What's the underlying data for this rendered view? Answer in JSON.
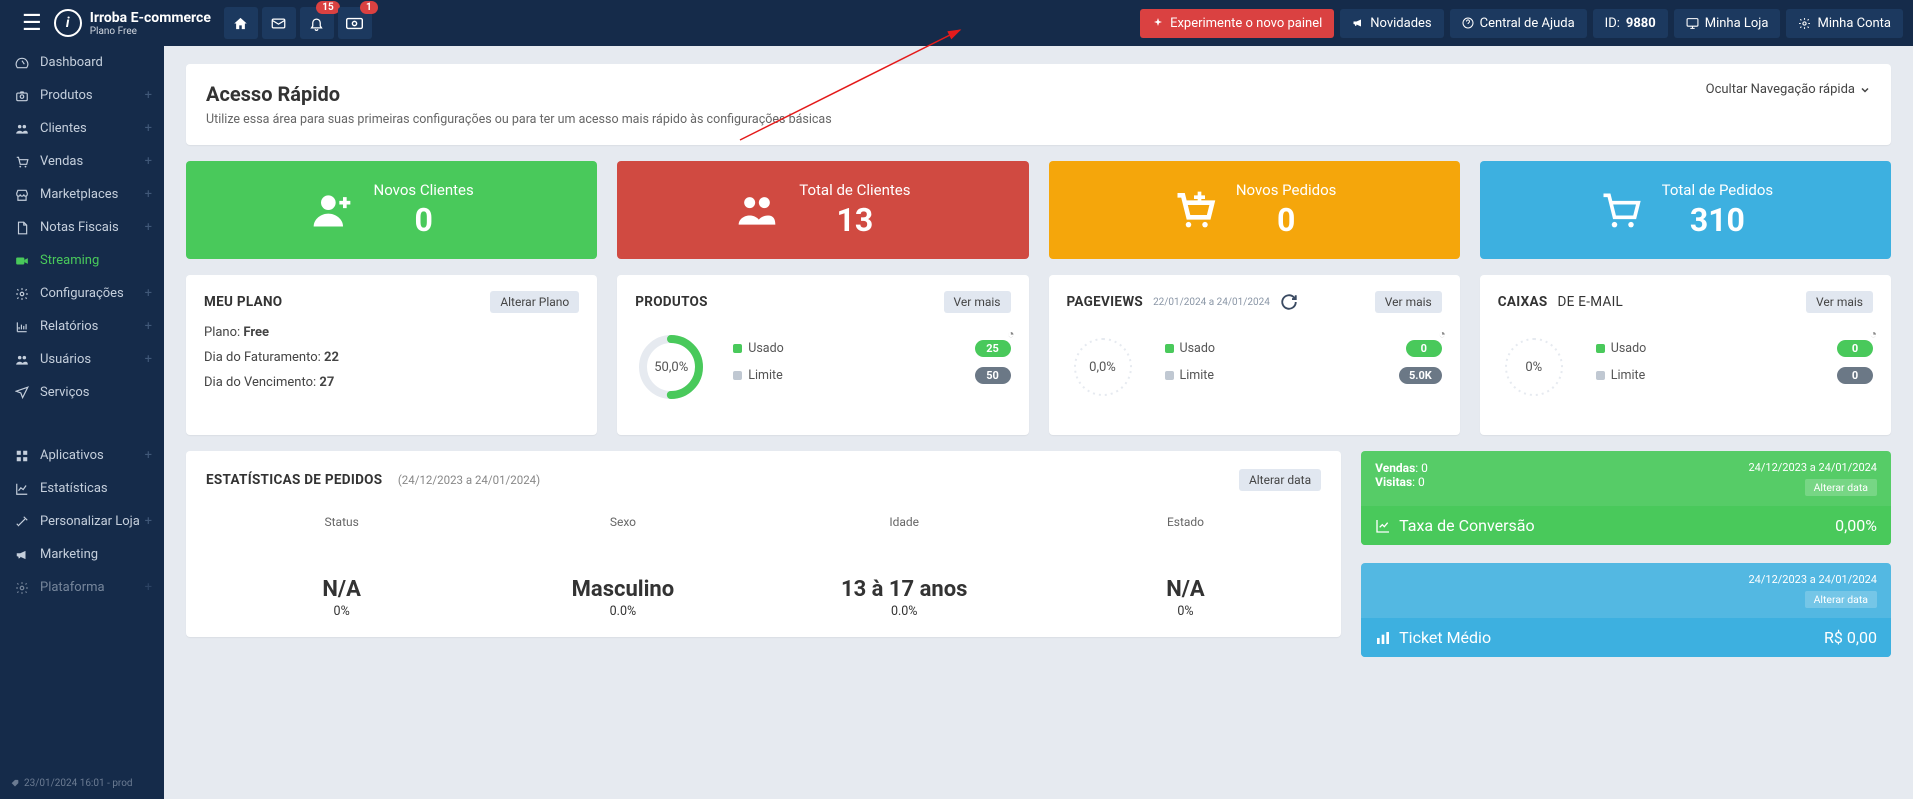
{
  "brand": {
    "title": "Irroba E-commerce",
    "subtitle": "Plano Free"
  },
  "topbar": {
    "notifBadge": "15",
    "moneyBadge": "1",
    "tryPanel": "Experimente o novo painel",
    "news": "Novidades",
    "help": "Central de Ajuda",
    "idLabel": "ID:",
    "idValue": "9880",
    "store": "Minha Loja",
    "account": "Minha Conta"
  },
  "sidebar": {
    "items": [
      {
        "label": "Dashboard",
        "icon": "tachometer",
        "plus": false
      },
      {
        "label": "Produtos",
        "icon": "camera",
        "plus": true
      },
      {
        "label": "Clientes",
        "icon": "users",
        "plus": true
      },
      {
        "label": "Vendas",
        "icon": "cart",
        "plus": true
      },
      {
        "label": "Marketplaces",
        "icon": "store",
        "plus": true
      },
      {
        "label": "Notas Fiscais",
        "icon": "file",
        "plus": true
      },
      {
        "label": "Streaming",
        "icon": "video",
        "plus": false,
        "active": true
      },
      {
        "label": "Configurações",
        "icon": "cogs",
        "plus": true
      },
      {
        "label": "Relatórios",
        "icon": "chart",
        "plus": true
      },
      {
        "label": "Usuários",
        "icon": "users",
        "plus": true
      },
      {
        "label": "Serviços",
        "icon": "plane",
        "plus": false
      }
    ],
    "items2": [
      {
        "label": "Aplicativos",
        "icon": "apps",
        "plus": true
      },
      {
        "label": "Estatísticas",
        "icon": "line",
        "plus": false
      },
      {
        "label": "Personalizar Loja",
        "icon": "wand",
        "plus": true
      },
      {
        "label": "Marketing",
        "icon": "bull",
        "plus": false
      },
      {
        "label": "Plataforma",
        "icon": "cogs",
        "plus": true,
        "muted": true
      }
    ],
    "footer": "23/01/2024 16:01 - prod"
  },
  "quickAccess": {
    "title": "Acesso Rápido",
    "subtitle": "Utilize essa área para suas primeiras configurações ou para ter um acesso mais rápido às configurações básicas",
    "toggle": "Ocultar Navegação rápida"
  },
  "stats": [
    {
      "label": "Novos Clientes",
      "value": "0",
      "color": "green",
      "icon": "user-plus"
    },
    {
      "label": "Total de Clientes",
      "value": "13",
      "color": "red",
      "icon": "users"
    },
    {
      "label": "Novos Pedidos",
      "value": "0",
      "color": "orange",
      "icon": "cart-plus"
    },
    {
      "label": "Total de Pedidos",
      "value": "310",
      "color": "blue",
      "icon": "cart"
    }
  ],
  "myplan": {
    "title": "MEU PLANO",
    "btn": "Alterar Plano",
    "planLabel": "Plano:",
    "planValue": "Free",
    "billLabel": "Dia do Faturamento:",
    "billValue": "22",
    "dueLabel": "Dia do Vencimento:",
    "dueValue": "27"
  },
  "panels": {
    "products": {
      "title": "PRODUTOS",
      "more": "Ver mais",
      "gauge": "50,0%",
      "usedLabel": "Usado",
      "usedVal": "25",
      "limitLabel": "Limite",
      "limitVal": "50",
      "pct": 50,
      "color": "#49c95b"
    },
    "pageviews": {
      "title": "PAGEVIEWS",
      "range": "22/01/2024 a 24/01/2024",
      "more": "Ver mais",
      "gauge": "0,0%",
      "usedLabel": "Usado",
      "usedVal": "0",
      "limitLabel": "Limite",
      "limitVal": "5.0K",
      "pct": 0,
      "color": "#49c95b"
    },
    "caixas": {
      "title": "CAIXAS",
      "title2": "DE E-MAIL",
      "more": "Ver mais",
      "gauge": "0%",
      "usedLabel": "Usado",
      "usedVal": "0",
      "limitLabel": "Limite",
      "limitVal": "0",
      "pct": 0,
      "color": "#49c95b"
    }
  },
  "orderStats": {
    "title": "ESTATÍSTICAS DE PEDIDOS",
    "range": "(24/12/2023 a 24/01/2024)",
    "btn": "Alterar data",
    "cols": [
      {
        "head": "Status",
        "val": "N/A",
        "pct": "0%"
      },
      {
        "head": "Sexo",
        "val": "Masculino",
        "pct": "0.0%"
      },
      {
        "head": "Idade",
        "val": "13 à 17 anos",
        "pct": "0.0%"
      },
      {
        "head": "Estado",
        "val": "N/A",
        "pct": "0%"
      }
    ]
  },
  "sideboxes": {
    "green": {
      "salesLabel": "Vendas",
      "salesVal": "0",
      "visitsLabel": "Visitas",
      "visitsVal": "0",
      "range": "24/12/2023 a 24/01/2024",
      "alter": "Alterar data",
      "bottomLabel": "Taxa de Conversão",
      "bottomVal": "0,00%"
    },
    "blue": {
      "range": "24/12/2023 a 24/01/2024",
      "alter": "Alterar data",
      "bottomLabel": "Ticket Médio",
      "bottomVal": "R$ 0,00"
    }
  },
  "chart_data": [
    {
      "type": "pie",
      "title": "Produtos",
      "categories": [
        "Usado",
        "Limite"
      ],
      "values": [
        25,
        50
      ],
      "ylabel": "",
      "xlabel": ""
    },
    {
      "type": "pie",
      "title": "Pageviews",
      "categories": [
        "Usado",
        "Limite"
      ],
      "values": [
        0,
        5000
      ],
      "ylabel": "",
      "xlabel": ""
    },
    {
      "type": "pie",
      "title": "Caixas de E-mail",
      "categories": [
        "Usado",
        "Limite"
      ],
      "values": [
        0,
        0
      ],
      "ylabel": "",
      "xlabel": ""
    }
  ]
}
